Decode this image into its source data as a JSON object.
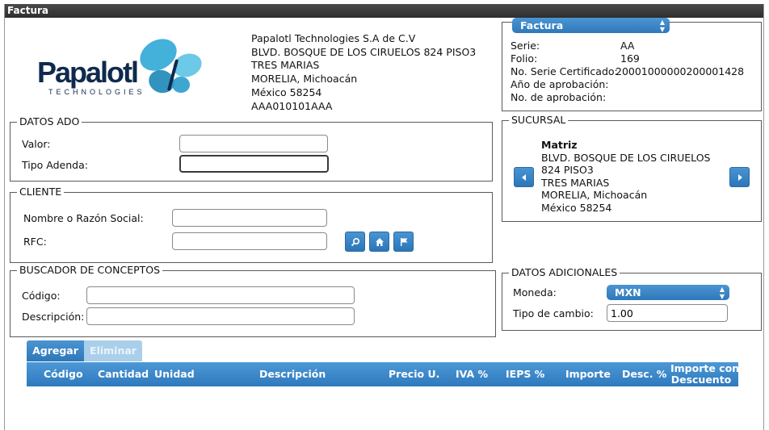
{
  "window": {
    "title": "Factura"
  },
  "logo": {
    "word": "Papalotl",
    "sub": "TECHNOLOGIES"
  },
  "issuer": {
    "lines": [
      "Papalotl Technologies S.A de C.V",
      "BLVD. BOSQUE DE LOS CIRUELOS 824 PISO3",
      "TRES MARIAS",
      "MORELIA, Michoacán",
      "México 58254",
      "AAA010101AAA"
    ]
  },
  "document": {
    "type_select": "Factura",
    "fields": [
      {
        "label": "Serie:",
        "value": "AA"
      },
      {
        "label": "Folio:",
        "value": "169"
      },
      {
        "label": "No. Serie Certificado:",
        "value": "20001000000200001428"
      },
      {
        "label": "Año de aprobación:",
        "value": ""
      },
      {
        "label": "No. de aprobación:",
        "value": ""
      }
    ]
  },
  "datos_ado": {
    "legend": "DATOS ADO",
    "valor_label": "Valor:",
    "valor_value": "",
    "tipo_adenda_label": "Tipo Adenda:",
    "tipo_adenda_value": ""
  },
  "sucursal": {
    "legend": "SUCURSAL",
    "name": "Matriz",
    "lines": [
      "BLVD. BOSQUE DE LOS CIRUELOS",
      "824 PISO3",
      "TRES MARIAS",
      "MORELIA, Michoacán",
      "México 58254"
    ]
  },
  "cliente": {
    "legend": "CLIENTE",
    "nombre_label": "Nombre o Razón Social:",
    "nombre_value": "",
    "rfc_label": "RFC:",
    "rfc_value": ""
  },
  "buscador": {
    "legend": "BUSCADOR DE CONCEPTOS",
    "codigo_label": "Código:",
    "codigo_value": "",
    "descripcion_label": "Descripción:",
    "descripcion_value": ""
  },
  "adicionales": {
    "legend": "DATOS ADICIONALES",
    "moneda_label": "Moneda:",
    "moneda_value": "MXN",
    "tipo_cambio_label": "Tipo de cambio:",
    "tipo_cambio_value": "1.00"
  },
  "actions": {
    "agregar": "Agregar",
    "eliminar": "Eliminar"
  },
  "table": {
    "headers": [
      "Código",
      "Cantidad",
      "Unidad",
      "Descripción",
      "Precio U.",
      "IVA %",
      "IEPS %",
      "Importe",
      "Desc. %",
      "Importe con",
      "Descuento"
    ]
  },
  "icons": [
    "search-icon",
    "home-icon",
    "flag-icon",
    "chevron-left-icon",
    "chevron-right-icon"
  ],
  "colors": {
    "accent": "#3a86c8",
    "titlebar": "#3a3a3a"
  }
}
